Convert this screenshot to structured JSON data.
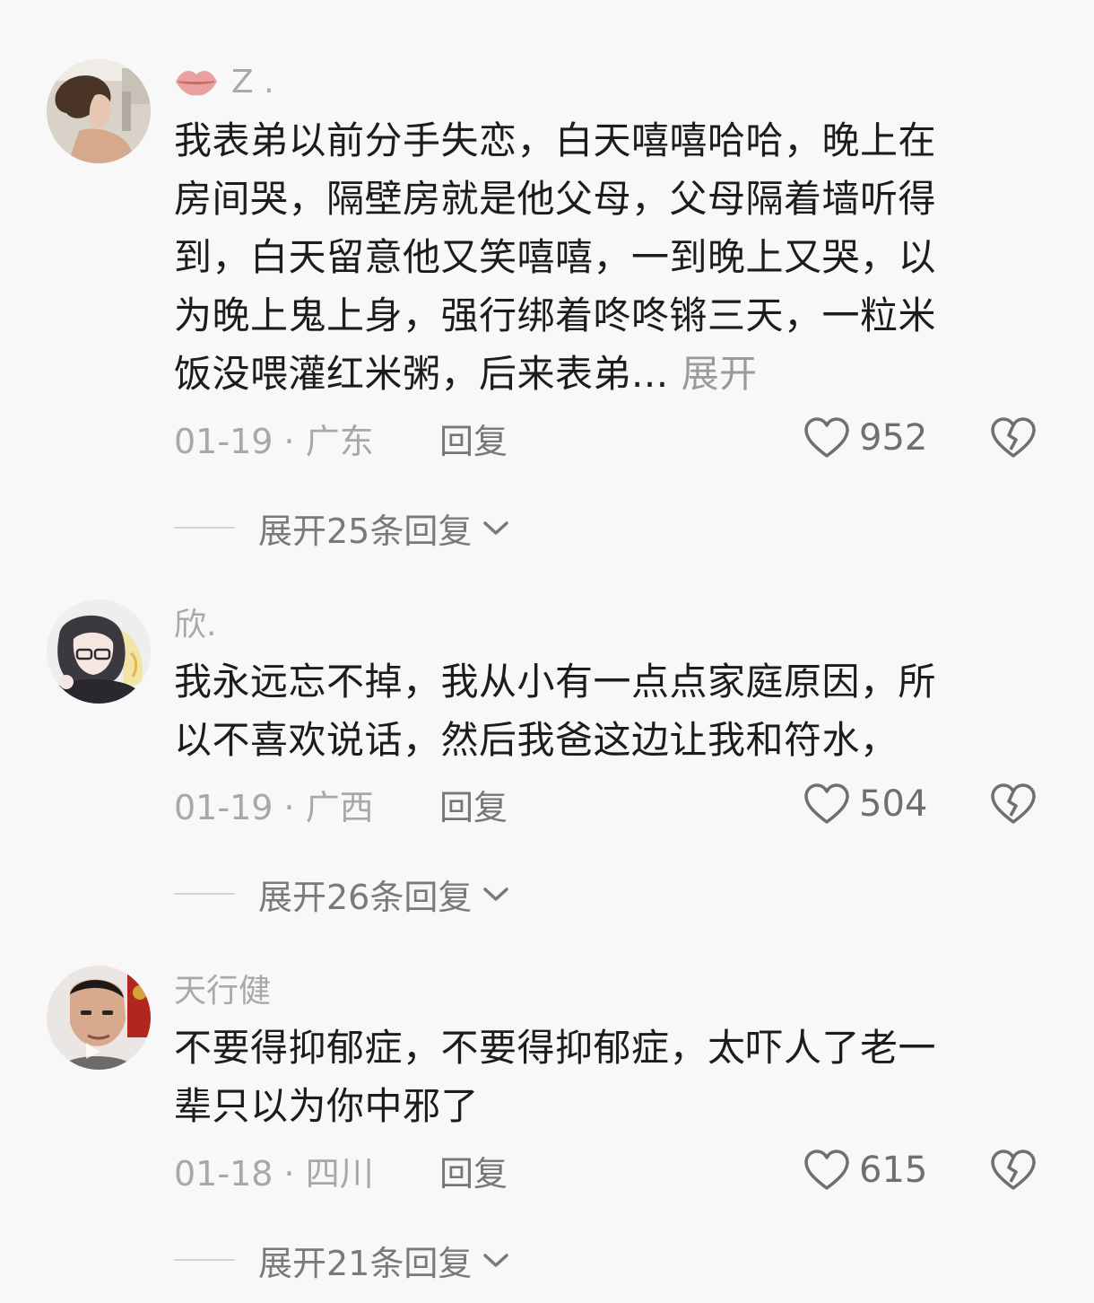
{
  "comments": [
    {
      "username": "Z .",
      "avatar_icon": "avatar-photo-icon",
      "username_icon": "lips-icon",
      "body_lines": [
        "我表弟以前分手失恋，白天嘻嘻哈哈，晚上在",
        "房间哭，隔壁房就是他父母，父母隔着墙听得",
        "到，白天留意他又笑嘻嘻，一到晚上又哭，以",
        "为晚上鬼上身，强行绑着咚咚锵三天，一粒米",
        "饭没喂灌红米粥，后来表弟..."
      ],
      "expand_text_label": "展开",
      "date": "01-19",
      "separator": "·",
      "location": "广东",
      "reply_label": "回复",
      "likes": "952",
      "expand_replies_label": "展开25条回复"
    },
    {
      "username": "欣.",
      "avatar_icon": "avatar-anime-icon",
      "body_lines": [
        "我永远忘不掉，我从小有一点点家庭原因，所",
        "以不喜欢说话，然后我爸这边让我和符水，"
      ],
      "date": "01-19",
      "separator": "·",
      "location": "广西",
      "reply_label": "回复",
      "likes": "504",
      "expand_replies_label": "展开26条回复"
    },
    {
      "username": "天行健",
      "avatar_icon": "avatar-man-icon",
      "body_lines": [
        "不要得抑郁症，不要得抑郁症，太吓人了老一",
        "辈只以为你中邪了"
      ],
      "date": "01-18",
      "separator": "·",
      "location": "四川",
      "reply_label": "回复",
      "likes": "615",
      "expand_replies_label": "展开21条回复"
    }
  ],
  "colors": {
    "background": "#f8f8f8",
    "text": "#1c1c1c",
    "muted": "#a8a8a8",
    "lips": "#e58b8b"
  }
}
